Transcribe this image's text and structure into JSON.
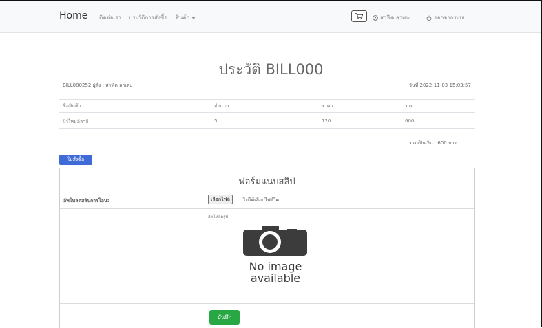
{
  "nav": {
    "brand": "Home",
    "contact": "ติดต่อเรา",
    "history": "ประวัติการสั่งซื้อ",
    "products": "สินค้า",
    "user": "สาฟิด ลาเตะ",
    "logout": "ออกจากระบบ"
  },
  "page": {
    "title": "ประวัติ BILL000",
    "bill_info": "BILL000252 ผู้สั่ง : สาฟิด ลาเตะ",
    "date_info": "วันที่ 2022-11-03 15:03:57"
  },
  "table": {
    "headers": [
      "ชื่อสินค้า",
      "จำนวน",
      "ราคา",
      "รวม"
    ],
    "rows": [
      [
        "ผ้าไหมอัลาลี",
        "5",
        "120",
        "600"
      ]
    ],
    "total": "รวมเป็นเงิน : 600 บาท"
  },
  "order_button": "ใบสั่งซื้อ",
  "form": {
    "title": "ฟอร์มแนบสลิป",
    "upload_label": "อัพโหลดสลิปการโอน:",
    "file_button": "เลือกไฟล์",
    "file_status": "ไม่ได้เลือกไฟล์ใด",
    "preview_label": "อัพโหลดรูป",
    "no_image_line1": "No image",
    "no_image_line2": "available",
    "save_button": "บันทึก"
  },
  "icons": [
    "cart-icon",
    "user-circle-icon",
    "power-icon",
    "camera-icon"
  ],
  "colors": {
    "primary": "#3f6ad8",
    "success": "#28a745",
    "navbar": "#f8f9fa"
  }
}
